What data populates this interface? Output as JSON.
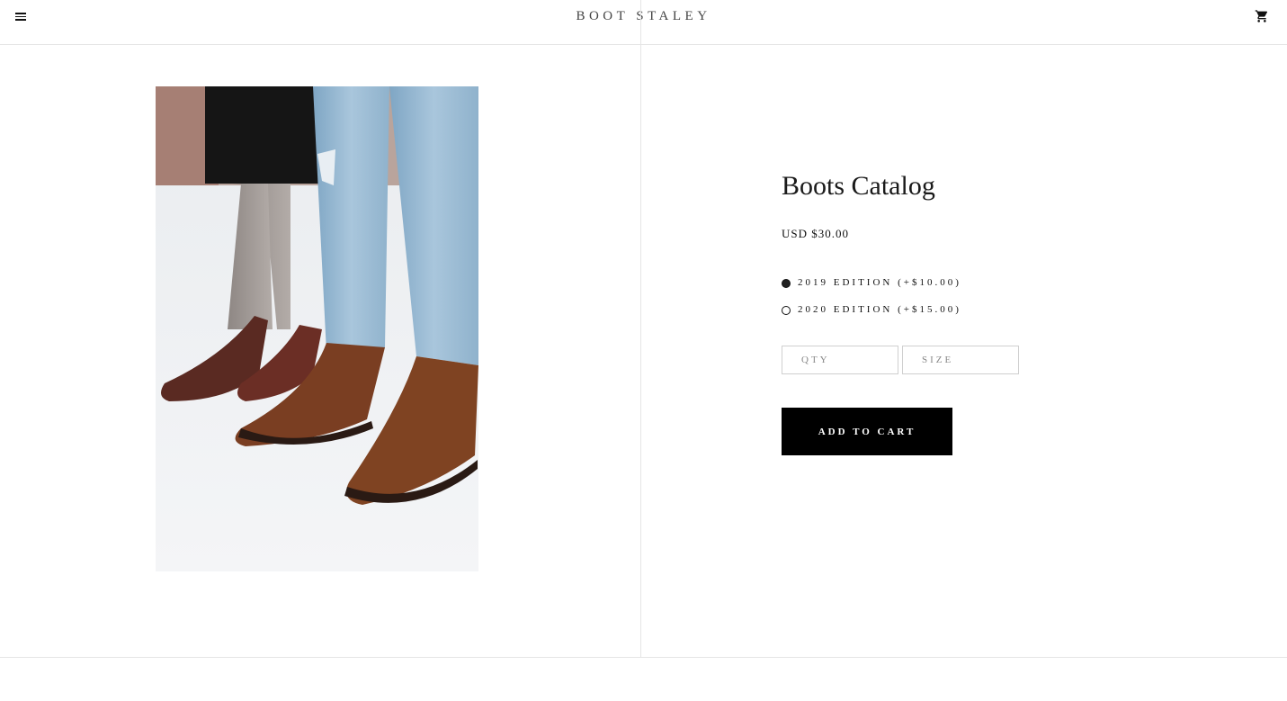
{
  "header": {
    "brand": "BOOT STALEY",
    "menu_icon": "menu-icon",
    "cart_icon": "cart-icon"
  },
  "product": {
    "title": "Boots Catalog",
    "price": "USD $30.00",
    "options": [
      {
        "label": "2019 EDITION (+$10.00)",
        "selected": true
      },
      {
        "label": "2020 EDITION (+$15.00)",
        "selected": false
      }
    ],
    "qty_placeholder": "QTY",
    "size_placeholder": "SIZE",
    "add_to_cart_label": "ADD TO CART"
  },
  "colors": {
    "accent": "#000000",
    "text": "#111111",
    "border": "#e5e5e5"
  }
}
